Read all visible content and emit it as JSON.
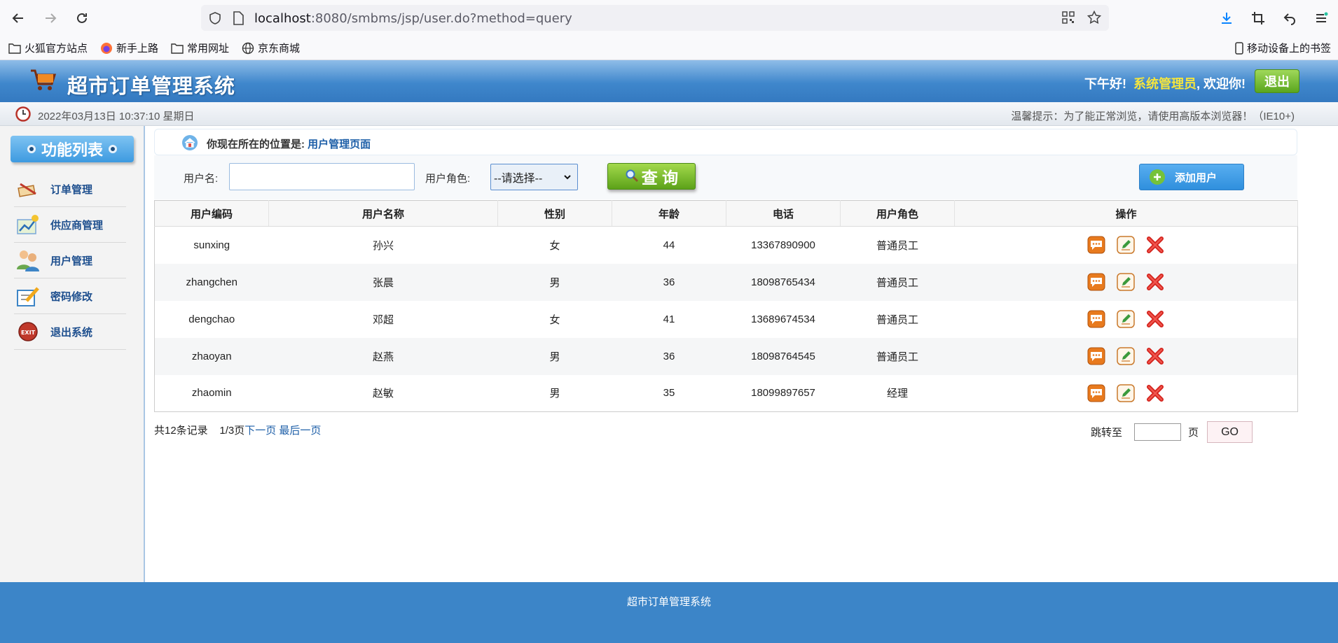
{
  "browser": {
    "url_host": "localhost",
    "url_rest": ":8080/smbms/jsp/user.do?method=query",
    "bookmarks": [
      "火狐官方站点",
      "新手上路",
      "常用网址",
      "京东商城"
    ],
    "mobile_bookmarks": "移动设备上的书签"
  },
  "header": {
    "title": "超市订单管理系统",
    "greeting": "下午好!",
    "username": "系统管理员",
    "welcome": ", 欢迎你!",
    "logout_label": "退出"
  },
  "info_bar": {
    "datetime": "2022年03月13日 10:37:10 星期日",
    "tip": "温馨提示：为了能正常浏览，请使用高版本浏览器！（IE10+)"
  },
  "sidebar": {
    "title": "功能列表",
    "items": [
      {
        "label": "订单管理",
        "icon": "order-icon"
      },
      {
        "label": "供应商管理",
        "icon": "provider-icon"
      },
      {
        "label": "用户管理",
        "icon": "users-icon"
      },
      {
        "label": "密码修改",
        "icon": "password-icon"
      },
      {
        "label": "退出系统",
        "icon": "exit-icon"
      }
    ]
  },
  "location": {
    "prefix": "你现在所在的位置是:",
    "page": "用户管理页面"
  },
  "search": {
    "username_label": "用户名:",
    "username_value": "",
    "role_label": "用户角色:",
    "role_selected": "--请选择--",
    "query_label": "查 询",
    "add_label": "添加用户"
  },
  "table": {
    "headers": [
      "用户编码",
      "用户名称",
      "性别",
      "年龄",
      "电话",
      "用户角色",
      "操作"
    ],
    "rows": [
      {
        "code": "sunxing",
        "name": "孙兴",
        "gender": "女",
        "age": "44",
        "phone": "13367890900",
        "role": "普通员工"
      },
      {
        "code": "zhangchen",
        "name": "张晨",
        "gender": "男",
        "age": "36",
        "phone": "18098765434",
        "role": "普通员工"
      },
      {
        "code": "dengchao",
        "name": "邓超",
        "gender": "女",
        "age": "41",
        "phone": "13689674534",
        "role": "普通员工"
      },
      {
        "code": "zhaoyan",
        "name": "赵燕",
        "gender": "男",
        "age": "36",
        "phone": "18098764545",
        "role": "普通员工"
      },
      {
        "code": "zhaomin",
        "name": "赵敏",
        "gender": "男",
        "age": "35",
        "phone": "18099897657",
        "role": "经理"
      }
    ]
  },
  "pager": {
    "total": "共12条记录",
    "page": "1/3页",
    "next": "下一页",
    "last": "最后一页",
    "jump_label": "跳转至",
    "page_unit": "页",
    "go_label": "GO"
  },
  "footer": {
    "text": "超市订单管理系统"
  },
  "colors": {
    "header_blue": "#3f87cc",
    "accent_green": "#5ca219",
    "username_yellow": "#f5e53d",
    "link_blue": "#1e5fa8"
  }
}
